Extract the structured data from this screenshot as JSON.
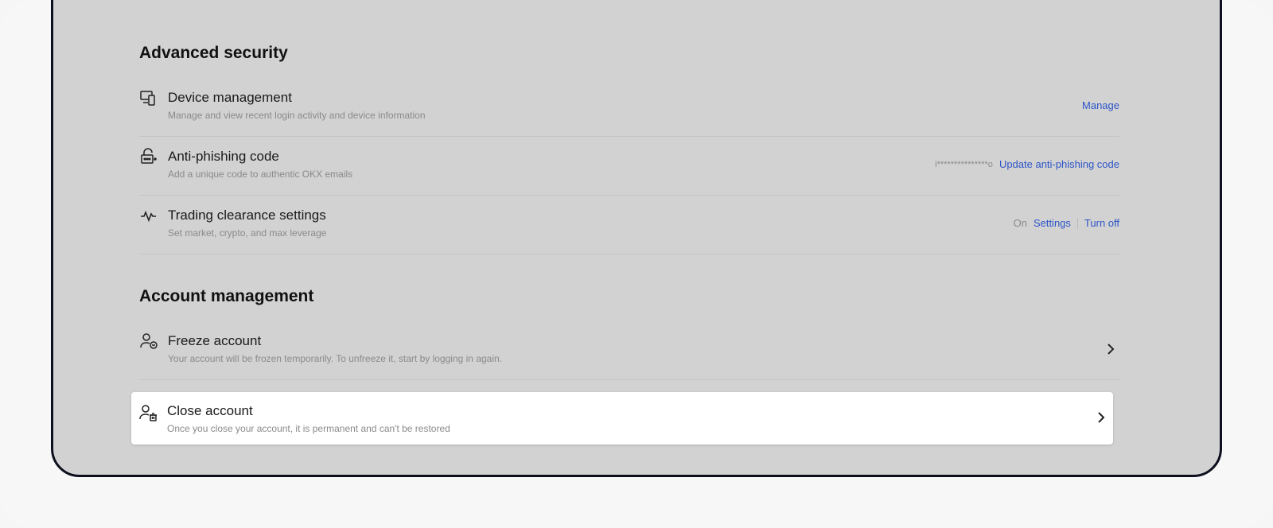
{
  "advanced_security": {
    "heading": "Advanced security",
    "rows": [
      {
        "title": "Device management",
        "desc": "Manage and view recent login activity and device information",
        "action": "Manage",
        "icon": "devices-icon"
      },
      {
        "title": "Anti-phishing code",
        "desc": "Add a unique code to authentic OKX emails",
        "masked_code": "i***************o",
        "action": "Update anti-phishing code",
        "icon": "lock-code-icon"
      },
      {
        "title": "Trading clearance settings",
        "desc": "Set market, crypto, and max leverage",
        "status": "On",
        "action_settings": "Settings",
        "action_turn_off": "Turn off",
        "icon": "activity-icon"
      }
    ]
  },
  "account_management": {
    "heading": "Account management",
    "rows": [
      {
        "title": "Freeze account",
        "desc": "Your account will be frozen temporarily. To unfreeze it, start by logging in again.",
        "icon": "user-freeze-icon"
      },
      {
        "title": "Close account",
        "desc": "Once you close your account, it is permanent and can't be restored",
        "icon": "user-delete-icon"
      }
    ]
  },
  "colors": {
    "link": "#2d55c9",
    "chat_button": "#1652f0",
    "overlay": "#d2d2d2"
  }
}
